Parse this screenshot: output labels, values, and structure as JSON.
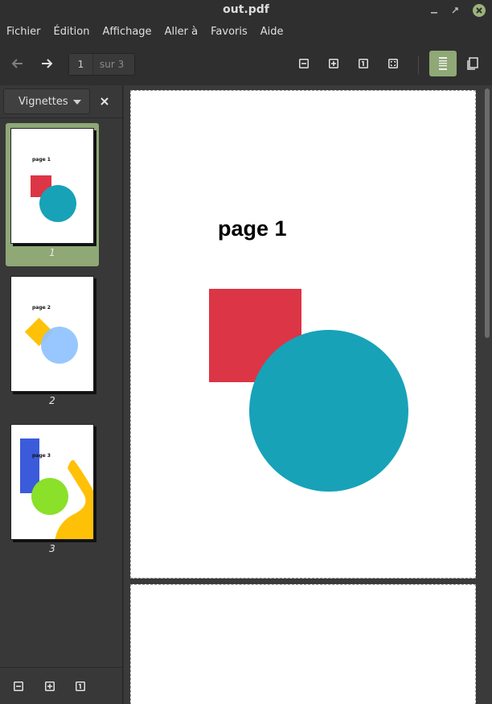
{
  "window": {
    "title": "out.pdf",
    "close_color": "#9bb37b"
  },
  "menu": [
    "Fichier",
    "Édition",
    "Affichage",
    "Aller à",
    "Favoris",
    "Aide"
  ],
  "toolbar": {
    "current_page": "1",
    "page_of": "sur 3",
    "icons": [
      "arrow-left-icon",
      "arrow-right-icon",
      "zoom-out-icon",
      "zoom-in-icon",
      "original-size-icon",
      "fit-page-icon",
      "continuous-view-icon",
      "dual-page-icon"
    ],
    "accent": "#8fa876"
  },
  "sidebar": {
    "mode_label": "Vignettes",
    "thumbnails": [
      {
        "label": "1",
        "text": "page 1",
        "selected": true
      },
      {
        "label": "2",
        "text": "page 2",
        "selected": false
      },
      {
        "label": "3",
        "text": "page 3",
        "selected": false
      }
    ],
    "bottom_icons": [
      "zoom-out-icon",
      "zoom-in-icon",
      "original-size-icon"
    ]
  },
  "document": {
    "page1_heading": "page 1",
    "shape_colors": {
      "square": "#dc3545",
      "circle": "#17a2b8",
      "yellow": "#ffc107",
      "lightblue": "#8fc2ff",
      "blue": "#3b5bdb",
      "green": "#8be02a"
    }
  }
}
